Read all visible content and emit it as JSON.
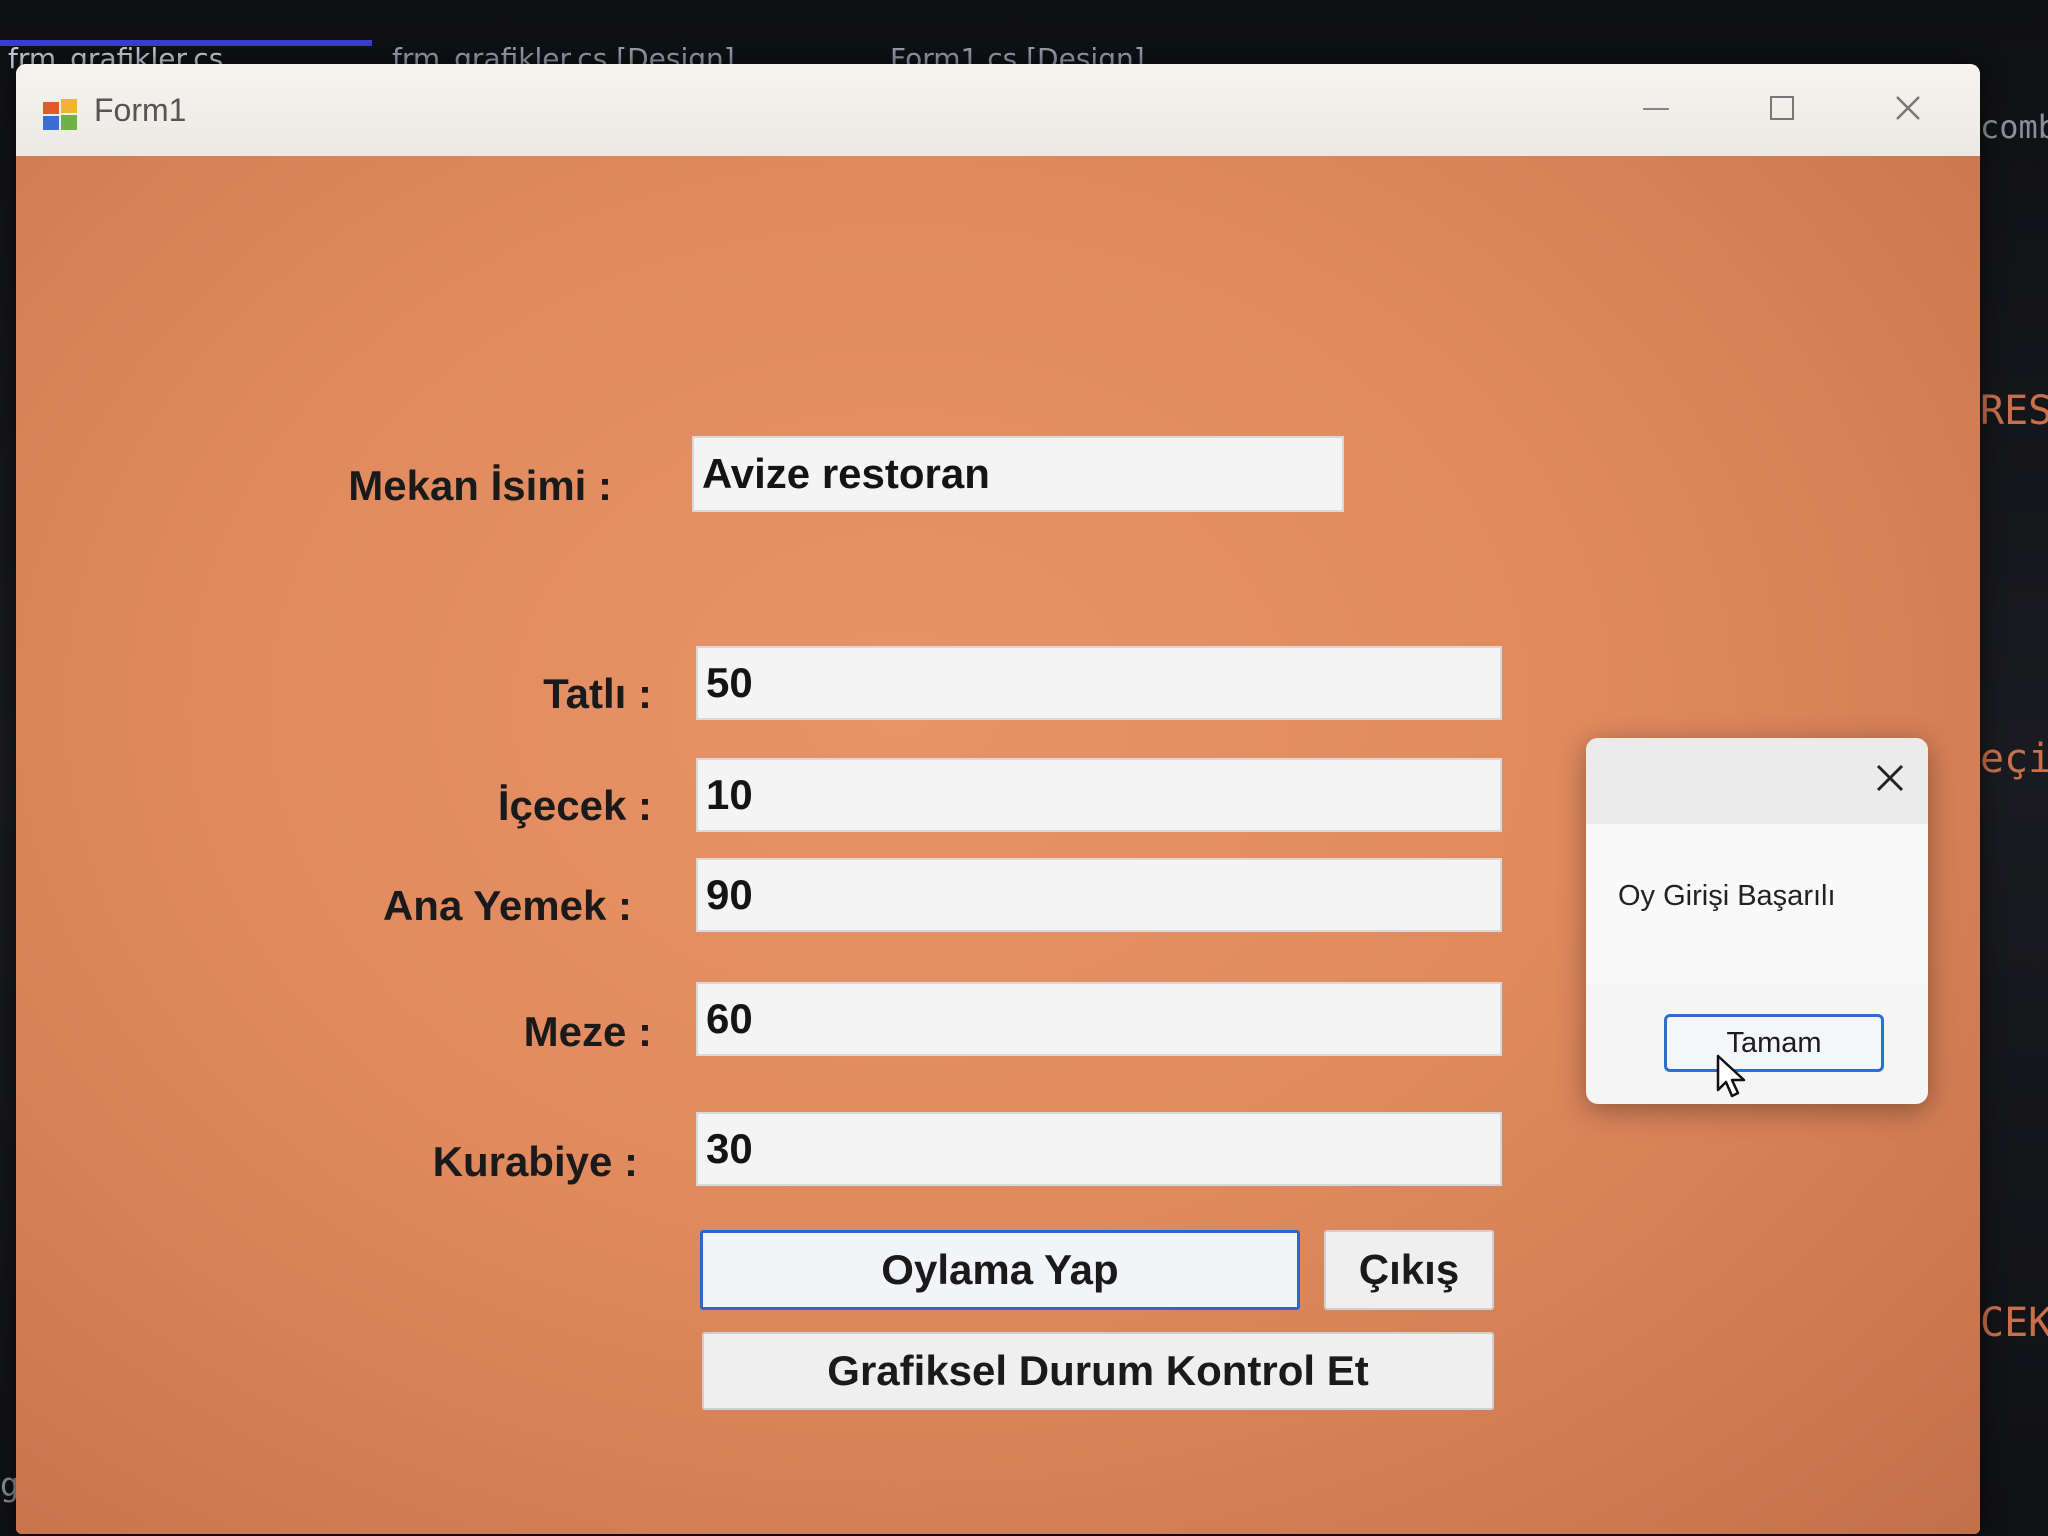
{
  "ide": {
    "tab1": "frm_grafikler.cs",
    "tab2": "frm_grafikler.cs [Design]",
    "tab3": "Form1.cs [Design]",
    "side1": "comb",
    "side2": "RES",
    "side3": "eçi",
    "side4": "CEK",
    "side5": "gs"
  },
  "window": {
    "title": "Form1",
    "min_icon": "minimize-icon",
    "max_icon": "maximize-icon",
    "close_icon": "close-icon"
  },
  "form": {
    "mekan_label": "Mekan İsimi :",
    "mekan_value": "Avize restoran",
    "tatli_label": "Tatlı :",
    "tatli_value": "50",
    "icecek_label": "İçecek :",
    "icecek_value": "10",
    "anayemek_label": "Ana Yemek :",
    "anayemek_value": "90",
    "meze_label": "Meze :",
    "meze_value": "60",
    "kurabiye_label": "Kurabiye :",
    "kurabiye_value": "30",
    "vote_button": "Oylama Yap",
    "exit_button": "Çıkış",
    "chart_button": "Grafiksel Durum Kontrol Et"
  },
  "dialog": {
    "message": "Oy Girişi Başarılı",
    "ok_button": "Tamam"
  },
  "colors": {
    "form_background": "#e08a5e",
    "focus_border": "#2b66c9"
  }
}
